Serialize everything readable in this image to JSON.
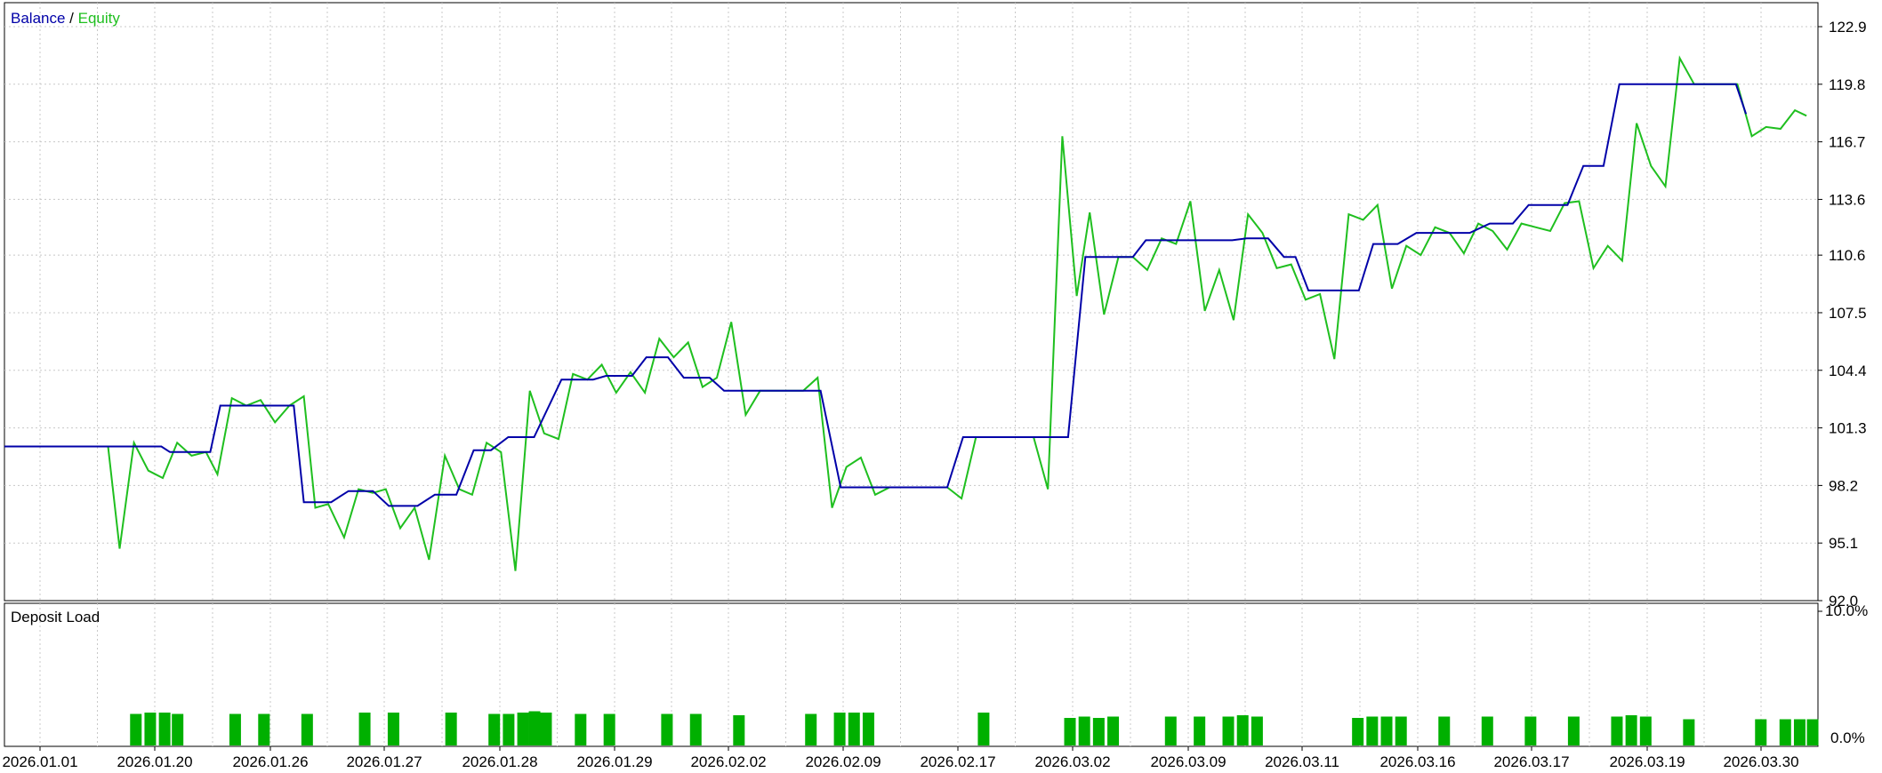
{
  "chart_data": [
    {
      "type": "line",
      "legend": {
        "balance_label": "Balance",
        "separator": " / ",
        "equity_label": "Equity",
        "placement": "top-left"
      },
      "ylim": [
        92.0,
        124.0
      ],
      "yticks": [
        "122.9",
        "119.8",
        "116.7",
        "113.6",
        "110.6",
        "107.5",
        "104.4",
        "101.3",
        "98.2",
        "95.1",
        "92.0"
      ],
      "xticks": [
        "2026.01.01",
        "2026.01.20",
        "2026.01.26",
        "2026.01.27",
        "2026.01.28",
        "2026.01.29",
        "2026.02.02",
        "2026.02.09",
        "2026.02.17",
        "2026.03.02",
        "2026.03.09",
        "2026.03.11",
        "2026.03.16",
        "2026.03.17",
        "2026.03.19",
        "2026.03.30"
      ],
      "grid": true,
      "colors": {
        "balance": "#0000a8",
        "equity": "#1fbf1f",
        "grid": "#c8c8c8",
        "frame": "#000000"
      },
      "series": [
        {
          "name": "Balance",
          "values": [
            [
              0,
              100.3
            ],
            [
              10.9,
              100.3
            ],
            [
              11.5,
              100.0
            ],
            [
              14.3,
              100.0
            ],
            [
              15.0,
              102.5
            ],
            [
              20.1,
              102.5
            ],
            [
              20.8,
              97.3
            ],
            [
              22.7,
              97.3
            ],
            [
              23.9,
              97.9
            ],
            [
              25.6,
              97.9
            ],
            [
              26.7,
              97.1
            ],
            [
              28.7,
              97.1
            ],
            [
              29.9,
              97.7
            ],
            [
              31.4,
              97.7
            ],
            [
              32.6,
              100.1
            ],
            [
              33.8,
              100.1
            ],
            [
              35.0,
              100.8
            ],
            [
              36.8,
              100.8
            ],
            [
              38.7,
              103.9
            ],
            [
              40.9,
              103.9
            ],
            [
              41.8,
              104.1
            ],
            [
              43.6,
              104.1
            ],
            [
              44.6,
              105.1
            ],
            [
              46.1,
              105.1
            ],
            [
              47.2,
              104.0
            ],
            [
              49.0,
              104.0
            ],
            [
              50.0,
              103.3
            ],
            [
              56.7,
              103.3
            ],
            [
              58.1,
              98.1
            ],
            [
              65.5,
              98.1
            ],
            [
              66.6,
              100.8
            ],
            [
              73.9,
              100.8
            ],
            [
              75.1,
              110.5
            ],
            [
              78.4,
              110.5
            ],
            [
              79.3,
              111.4
            ],
            [
              85.3,
              111.4
            ],
            [
              86.3,
              111.5
            ],
            [
              87.8,
              111.5
            ],
            [
              88.9,
              110.5
            ],
            [
              89.7,
              110.5
            ],
            [
              90.6,
              108.7
            ],
            [
              94.1,
              108.7
            ],
            [
              95.1,
              111.2
            ],
            [
              96.8,
              111.2
            ],
            [
              98.1,
              111.8
            ],
            [
              101.8,
              111.8
            ],
            [
              103.2,
              112.3
            ],
            [
              104.8,
              112.3
            ],
            [
              105.9,
              113.3
            ],
            [
              108.6,
              113.3
            ],
            [
              109.7,
              115.4
            ],
            [
              111.1,
              115.4
            ],
            [
              112.2,
              119.8
            ],
            [
              120.3,
              119.8
            ],
            [
              121.0,
              118.2
            ]
          ]
        },
        {
          "name": "Equity",
          "values": [
            [
              0,
              100.3
            ],
            [
              7.2,
              100.3
            ],
            [
              8.0,
              94.8
            ],
            [
              9.0,
              100.5
            ],
            [
              10.0,
              99.0
            ],
            [
              11.0,
              98.6
            ],
            [
              12.0,
              100.5
            ],
            [
              13.0,
              99.8
            ],
            [
              14.0,
              100.0
            ],
            [
              14.8,
              98.8
            ],
            [
              15.8,
              102.9
            ],
            [
              16.8,
              102.5
            ],
            [
              17.8,
              102.8
            ],
            [
              18.8,
              101.6
            ],
            [
              19.8,
              102.5
            ],
            [
              20.8,
              103.0
            ],
            [
              21.6,
              97.0
            ],
            [
              22.5,
              97.2
            ],
            [
              23.6,
              95.4
            ],
            [
              24.6,
              98.0
            ],
            [
              25.6,
              97.8
            ],
            [
              26.5,
              98.0
            ],
            [
              27.5,
              95.9
            ],
            [
              28.5,
              97.0
            ],
            [
              29.5,
              94.2
            ],
            [
              30.6,
              99.8
            ],
            [
              31.6,
              98.0
            ],
            [
              32.5,
              97.7
            ],
            [
              33.5,
              100.5
            ],
            [
              34.5,
              100.0
            ],
            [
              35.5,
              93.6
            ],
            [
              36.5,
              103.3
            ],
            [
              37.5,
              101.0
            ],
            [
              38.5,
              100.7
            ],
            [
              39.5,
              104.2
            ],
            [
              40.5,
              103.9
            ],
            [
              41.5,
              104.7
            ],
            [
              42.5,
              103.2
            ],
            [
              43.5,
              104.3
            ],
            [
              44.5,
              103.2
            ],
            [
              45.5,
              106.1
            ],
            [
              46.5,
              105.1
            ],
            [
              47.5,
              105.9
            ],
            [
              48.5,
              103.5
            ],
            [
              49.5,
              104.0
            ],
            [
              50.5,
              107.0
            ],
            [
              51.5,
              102.0
            ],
            [
              52.5,
              103.3
            ],
            [
              55.5,
              103.3
            ],
            [
              56.5,
              104.0
            ],
            [
              57.5,
              97.0
            ],
            [
              58.5,
              99.2
            ],
            [
              59.5,
              99.7
            ],
            [
              60.5,
              97.7
            ],
            [
              61.5,
              98.1
            ],
            [
              65.5,
              98.1
            ],
            [
              66.5,
              97.5
            ],
            [
              67.5,
              100.8
            ],
            [
              71.5,
              100.8
            ],
            [
              72.5,
              98.0
            ],
            [
              73.5,
              117.0
            ],
            [
              74.5,
              108.4
            ],
            [
              75.4,
              112.9
            ],
            [
              76.4,
              107.4
            ],
            [
              77.4,
              110.5
            ],
            [
              78.4,
              110.5
            ],
            [
              79.4,
              109.8
            ],
            [
              80.4,
              111.5
            ],
            [
              81.4,
              111.2
            ],
            [
              82.4,
              113.5
            ],
            [
              83.4,
              107.6
            ],
            [
              84.4,
              109.8
            ],
            [
              85.4,
              107.1
            ],
            [
              86.4,
              112.8
            ],
            [
              87.4,
              111.8
            ],
            [
              88.4,
              109.9
            ],
            [
              89.4,
              110.1
            ],
            [
              90.4,
              108.2
            ],
            [
              91.4,
              108.5
            ],
            [
              92.4,
              105.0
            ],
            [
              93.4,
              112.8
            ],
            [
              94.4,
              112.5
            ],
            [
              95.4,
              113.3
            ],
            [
              96.4,
              108.8
            ],
            [
              97.4,
              111.1
            ],
            [
              98.4,
              110.6
            ],
            [
              99.4,
              112.1
            ],
            [
              100.4,
              111.8
            ],
            [
              101.4,
              110.7
            ],
            [
              102.4,
              112.3
            ],
            [
              103.4,
              111.9
            ],
            [
              104.4,
              110.9
            ],
            [
              105.4,
              112.3
            ],
            [
              106.4,
              112.1
            ],
            [
              107.4,
              111.9
            ],
            [
              108.4,
              113.4
            ],
            [
              109.4,
              113.5
            ],
            [
              110.4,
              109.9
            ],
            [
              111.4,
              111.1
            ],
            [
              112.4,
              110.3
            ],
            [
              113.4,
              117.7
            ],
            [
              114.4,
              115.4
            ],
            [
              115.4,
              114.3
            ],
            [
              116.4,
              121.2
            ],
            [
              117.4,
              119.8
            ],
            [
              120.4,
              119.8
            ],
            [
              121.4,
              117.0
            ],
            [
              122.4,
              117.5
            ],
            [
              123.4,
              117.4
            ],
            [
              124.4,
              118.4
            ],
            [
              125.2,
              118.1
            ]
          ]
        }
      ]
    },
    {
      "type": "bar",
      "title": "Deposit Load",
      "ylim": [
        0,
        10
      ],
      "yticks": [
        "10.0%",
        "0.0%"
      ],
      "colors": {
        "bars": "#00b000"
      },
      "values": [
        [
          9.1,
          2.3
        ],
        [
          10.1,
          2.4
        ],
        [
          11.1,
          2.4
        ],
        [
          12.0,
          2.3
        ],
        [
          16.0,
          2.3
        ],
        [
          18.0,
          2.3
        ],
        [
          21.0,
          2.3
        ],
        [
          25.0,
          2.4
        ],
        [
          27.0,
          2.4
        ],
        [
          31.0,
          2.4
        ],
        [
          34.0,
          2.3
        ],
        [
          35.0,
          2.3
        ],
        [
          36.0,
          2.4
        ],
        [
          36.8,
          2.5
        ],
        [
          37.6,
          2.4
        ],
        [
          40.0,
          2.3
        ],
        [
          42.0,
          2.3
        ],
        [
          46.0,
          2.3
        ],
        [
          48.0,
          2.3
        ],
        [
          51.0,
          2.2
        ],
        [
          56.0,
          2.3
        ],
        [
          58.0,
          2.4
        ],
        [
          59.0,
          2.4
        ],
        [
          60.0,
          2.4
        ],
        [
          68.0,
          2.4
        ],
        [
          74.0,
          2.0
        ],
        [
          75.0,
          2.1
        ],
        [
          76.0,
          2.0
        ],
        [
          77.0,
          2.1
        ],
        [
          81.0,
          2.1
        ],
        [
          83.0,
          2.1
        ],
        [
          85.0,
          2.1
        ],
        [
          86.0,
          2.2
        ],
        [
          87.0,
          2.1
        ],
        [
          94.0,
          2.0
        ],
        [
          95.0,
          2.1
        ],
        [
          96.0,
          2.1
        ],
        [
          97.0,
          2.1
        ],
        [
          100.0,
          2.1
        ],
        [
          103.0,
          2.1
        ],
        [
          106.0,
          2.1
        ],
        [
          109.0,
          2.1
        ],
        [
          112.0,
          2.1
        ],
        [
          113.0,
          2.2
        ],
        [
          114.0,
          2.1
        ],
        [
          117.0,
          1.9
        ],
        [
          122.0,
          1.9
        ],
        [
          123.7,
          1.9
        ],
        [
          124.7,
          1.9
        ],
        [
          125.6,
          1.9
        ]
      ]
    }
  ]
}
